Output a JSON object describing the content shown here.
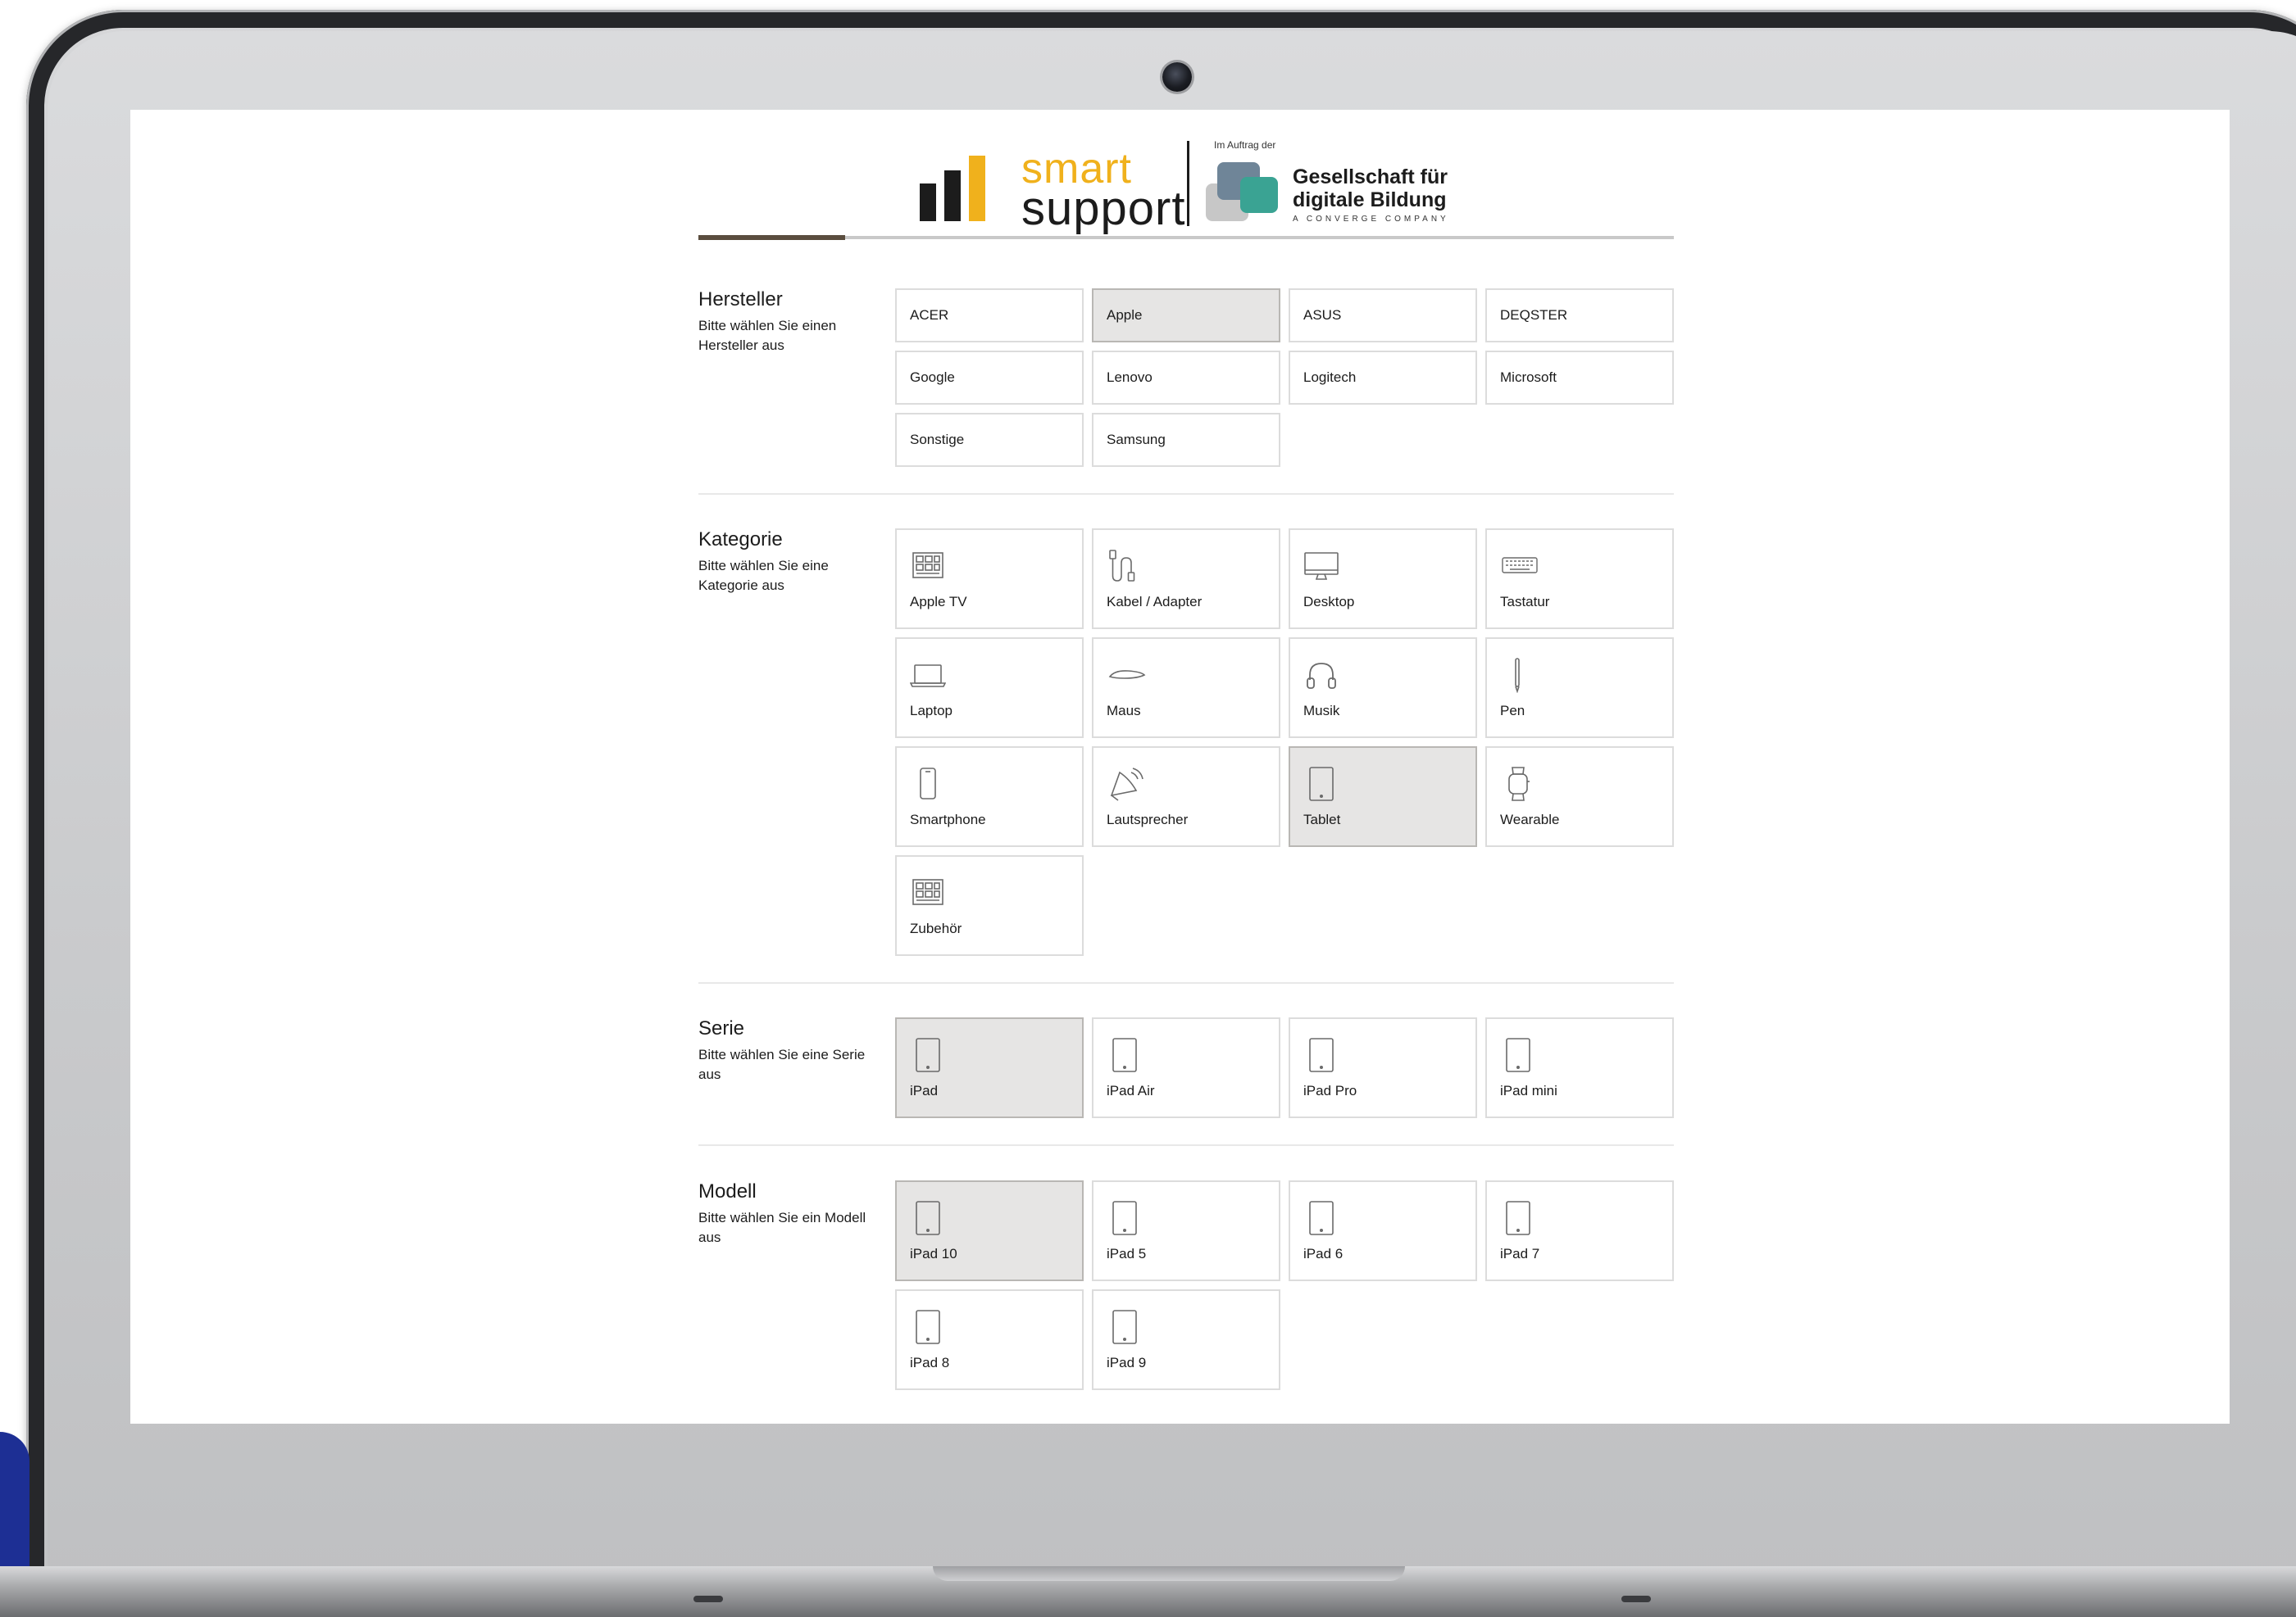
{
  "brand": {
    "smart": "smart",
    "support": "support",
    "bar_colors": [
      "#1c1c1c",
      "#1c1c1c",
      "#f0b11c"
    ],
    "partner_prefix": "Im Auftrag der",
    "partner_line1": "Gesellschaft für",
    "partner_line2": "digitale Bildung",
    "partner_tagline": "A CONVERGE COMPANY",
    "partner_colors": [
      "#6f8598",
      "#c7c7c7",
      "#3aa393"
    ]
  },
  "progress": {
    "fraction": 0.15,
    "color": "#5a4d3e"
  },
  "colors": {
    "selected_bg": "#e6e5e4",
    "card_border": "#dcdcdc"
  },
  "hersteller": {
    "title": "Hersteller",
    "desc": "Bitte wählen Sie einen Hersteller aus",
    "items": [
      {
        "label": "ACER",
        "selected": false
      },
      {
        "label": "Apple",
        "selected": true
      },
      {
        "label": "ASUS",
        "selected": false
      },
      {
        "label": "DEQSTER",
        "selected": false
      },
      {
        "label": "Google",
        "selected": false
      },
      {
        "label": "Lenovo",
        "selected": false
      },
      {
        "label": "Logitech",
        "selected": false
      },
      {
        "label": "Microsoft",
        "selected": false
      },
      {
        "label": "Sonstige",
        "selected": false
      },
      {
        "label": "Samsung",
        "selected": false
      }
    ]
  },
  "kategorie": {
    "title": "Kategorie",
    "desc": "Bitte wählen Sie eine Kategorie aus",
    "items": [
      {
        "label": "Apple TV",
        "icon": "grid-placeholder-icon",
        "selected": false
      },
      {
        "label": "Kabel / Adapter",
        "icon": "cable-icon",
        "selected": false
      },
      {
        "label": "Desktop",
        "icon": "monitor-icon",
        "selected": false
      },
      {
        "label": "Tastatur",
        "icon": "keyboard-icon",
        "selected": false
      },
      {
        "label": "Laptop",
        "icon": "laptop-icon",
        "selected": false
      },
      {
        "label": "Maus",
        "icon": "mouse-icon",
        "selected": false
      },
      {
        "label": "Musik",
        "icon": "headphones-icon",
        "selected": false
      },
      {
        "label": "Pen",
        "icon": "pen-icon",
        "selected": false
      },
      {
        "label": "Smartphone",
        "icon": "smartphone-icon",
        "selected": false
      },
      {
        "label": "Lautsprecher",
        "icon": "speaker-icon",
        "selected": false
      },
      {
        "label": "Tablet",
        "icon": "tablet-icon",
        "selected": true
      },
      {
        "label": "Wearable",
        "icon": "watch-icon",
        "selected": false
      },
      {
        "label": "Zubehör",
        "icon": "grid-placeholder-icon",
        "selected": false
      }
    ]
  },
  "serie": {
    "title": "Serie",
    "desc": "Bitte wählen Sie eine Serie aus",
    "items": [
      {
        "label": "iPad",
        "icon": "tablet-icon",
        "selected": true
      },
      {
        "label": "iPad Air",
        "icon": "tablet-icon",
        "selected": false
      },
      {
        "label": "iPad Pro",
        "icon": "tablet-icon",
        "selected": false
      },
      {
        "label": "iPad mini",
        "icon": "tablet-icon",
        "selected": false
      }
    ]
  },
  "modell": {
    "title": "Modell",
    "desc": "Bitte wählen Sie ein Modell aus",
    "items": [
      {
        "label": "iPad 10",
        "icon": "tablet-icon",
        "selected": true
      },
      {
        "label": "iPad 5",
        "icon": "tablet-icon",
        "selected": false
      },
      {
        "label": "iPad 6",
        "icon": "tablet-icon",
        "selected": false
      },
      {
        "label": "iPad 7",
        "icon": "tablet-icon",
        "selected": false
      },
      {
        "label": "iPad 8",
        "icon": "tablet-icon",
        "selected": false
      },
      {
        "label": "iPad 9",
        "icon": "tablet-icon",
        "selected": false
      }
    ]
  }
}
